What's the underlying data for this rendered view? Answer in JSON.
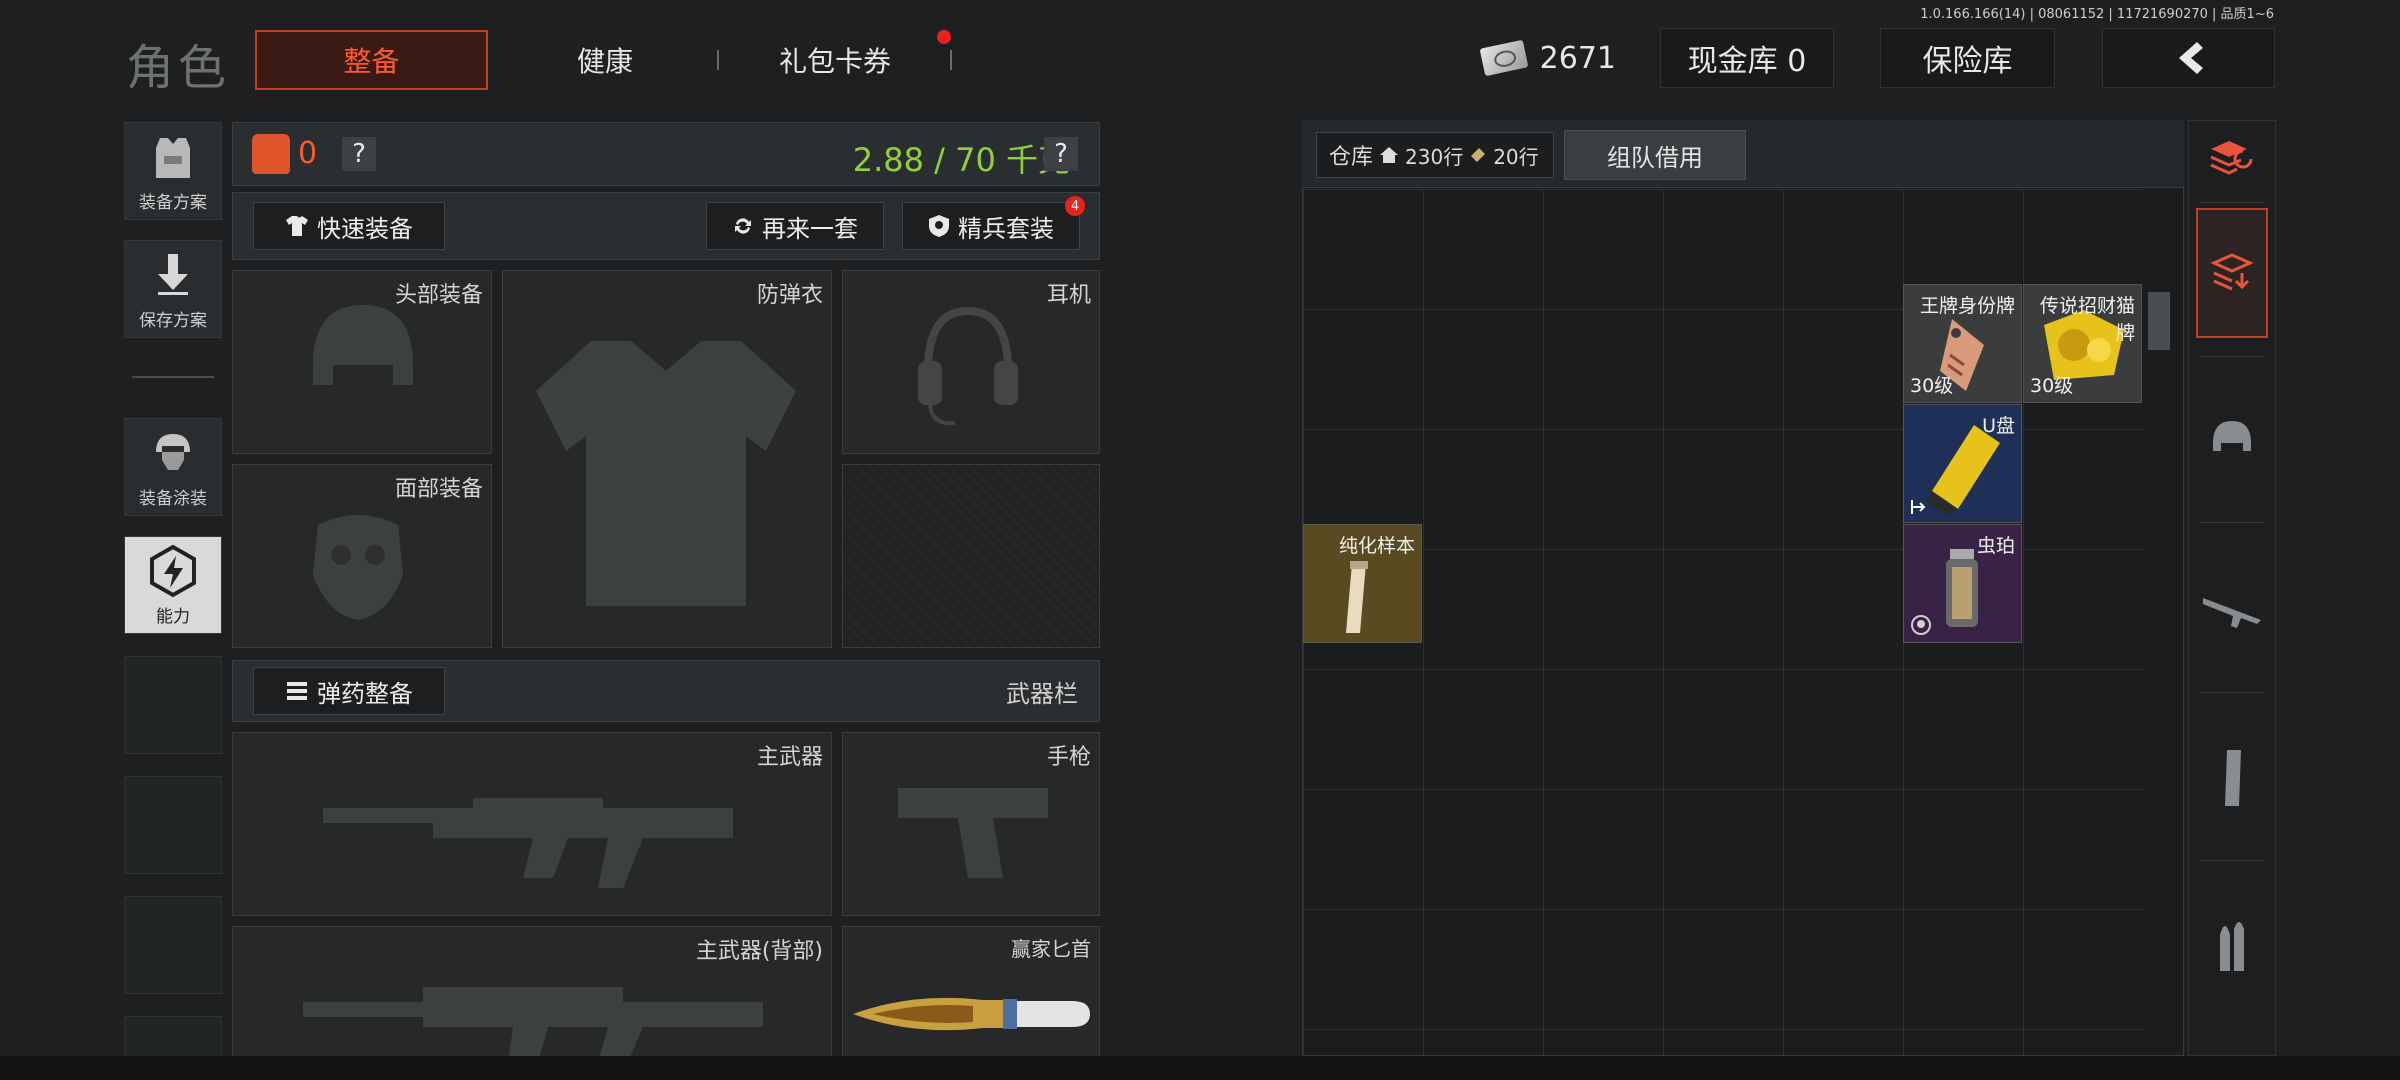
{
  "version": "1.0.166.166(14) | 08061152 | 11721690270 | 品质1~6",
  "top": {
    "title": "角色",
    "tabs": [
      {
        "label": "整备",
        "active": true
      },
      {
        "label": "健康",
        "active": false
      },
      {
        "label": "礼包卡券",
        "active": false
      }
    ],
    "money": "2671",
    "cash_storage": "现金库 0",
    "safe": "保险库",
    "accent": "#ff5a2e"
  },
  "side": {
    "plan": "装备方案",
    "save": "保存方案",
    "paint": "装备涂装",
    "ability": "能力"
  },
  "equip": {
    "armor_level": "0",
    "help": "?",
    "weight": "2.88 / 70 千克",
    "quick_equip": "快速装备",
    "again": "再来一套",
    "elite": "精兵套装",
    "elite_badge": "4",
    "slots": {
      "head": "头部装备",
      "armor": "防弹衣",
      "ear": "耳机",
      "face": "面部装备",
      "primary": "主武器",
      "pistol": "手枪",
      "primary_back": "主武器(背部)",
      "knife": "赢家匕首"
    },
    "ammo": "弹药整备",
    "weapon_bar": "武器栏"
  },
  "storage": {
    "title": "仓库",
    "rows_main": "230行",
    "rows_sub": "20行",
    "team_borrow": "组队借用",
    "items": [
      {
        "name": "王牌身份牌",
        "level": "30级"
      },
      {
        "name": "传说招财猫",
        "name2": "牌",
        "level": "30级"
      },
      {
        "name": "U盘"
      },
      {
        "name": "纯化样本"
      },
      {
        "name": "虫珀"
      }
    ]
  }
}
